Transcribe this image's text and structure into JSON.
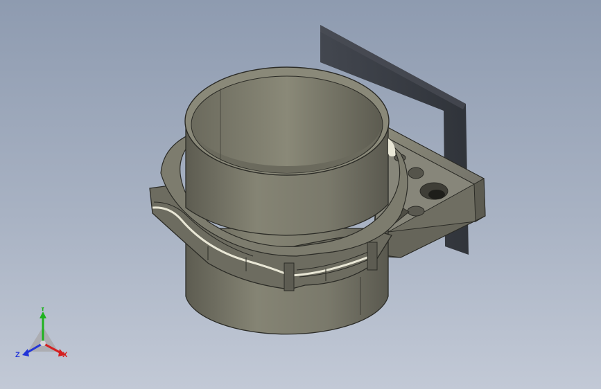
{
  "viewport": {
    "background_top": "#8e9bb0",
    "background_bottom": "#c2c9d6",
    "model": {
      "part_color": "#7b7a6c",
      "edge_color": "#2b2b26",
      "shadow_color": "#3c3f45",
      "highlight_color": "#e9e7d6"
    },
    "triad": {
      "x_label": "X",
      "y_label": "Y",
      "z_label": "Z",
      "x_color": "#d42020",
      "y_color": "#1fb21f",
      "z_color": "#2335d8"
    }
  }
}
